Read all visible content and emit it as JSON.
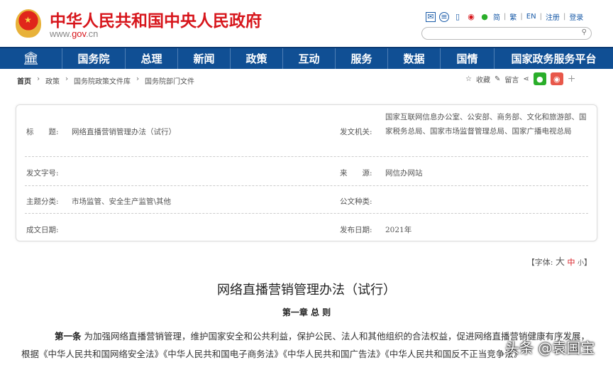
{
  "header": {
    "title": "中华人民共和国中央人民政府",
    "url_prefix": "www.",
    "url_mid": "gov",
    "url_suffix": ".cn",
    "tools": [
      "简",
      "繁",
      "EN",
      "注册",
      "登录"
    ],
    "search_placeholder": ""
  },
  "nav": {
    "items": [
      "国务院",
      "总理",
      "新闻",
      "政策",
      "互动",
      "服务",
      "数据",
      "国情",
      "国家政务服务平台"
    ]
  },
  "breadcrumb": [
    "首页",
    "政策",
    "国务院政策文件库",
    "国务院部门文件"
  ],
  "share": {
    "favorite": "收藏",
    "comment": "留言"
  },
  "info": {
    "title_label": "标　　题:",
    "title_value": "网络直播营销管理办法（试行）",
    "issuer_label": "发文机关:",
    "issuer_value": "国家互联网信息办公室、公安部、商务部、文化和旅游部、国家税务总局、国家市场监督管理总局、国家广播电视总局",
    "docno_label": "发文字号:",
    "docno_value": "",
    "source_label": "来　　源:",
    "source_value": "网信办网站",
    "topic_label": "主题分类:",
    "topic_value": "市场监管、安全生产监管\\其他",
    "type_label": "公文种类:",
    "type_value": "",
    "written_label": "成文日期:",
    "written_value": "",
    "published_label": "发布日期:",
    "published_value": "2021年"
  },
  "fontsize": {
    "prefix": "【字体:",
    "large": "大",
    "medium": "中",
    "small": "小",
    "suffix": "】"
  },
  "doc": {
    "title": "网络直播营销管理办法（试行）",
    "chapter": "第一章 总 则",
    "article_label": "第一条",
    "p1": "为加强网络直播营销管理，维护国家安全和公共利益，保护公民、法人和其他组织的合法权益，促进网络直播营销健康有序发展，根据《中华人民共和国网络安全法》《中华人民共和国电子商务法》《中华人民共和国广告法》《中华人民共和国反不正当竞争法》"
  },
  "watermark": "头条 @袁国宝",
  "colors": {
    "brand_red": "#d7161c",
    "nav_blue": "#104f94"
  }
}
